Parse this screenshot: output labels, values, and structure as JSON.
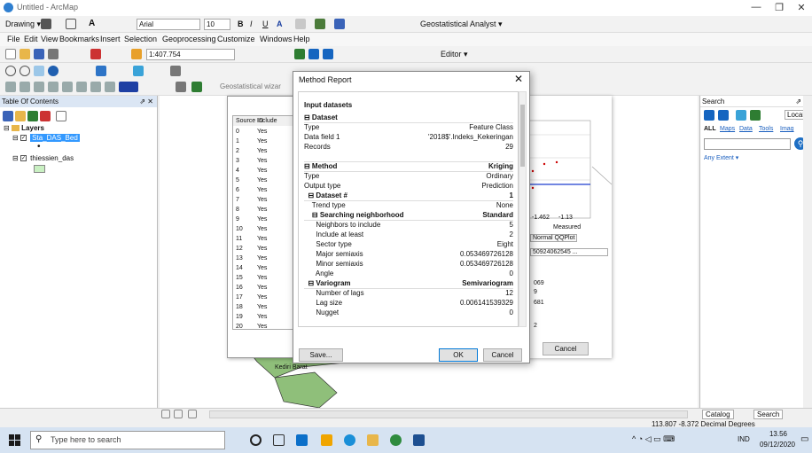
{
  "window": {
    "title": "Untitled - ArcMap",
    "minimize": "—",
    "maximize": "❐",
    "close": "✕"
  },
  "toolbar1": {
    "drawing": "Drawing ▾",
    "font": "Arial",
    "size": "10",
    "bold": "B",
    "italic": "I",
    "underline": "U",
    "font_color": "A",
    "geostat": "Geostatistical Analyst ▾"
  },
  "menu": [
    "File",
    "Edit",
    "View",
    "Bookmarks",
    "Insert",
    "Selection",
    "Geoprocessing",
    "Customize",
    "Windows",
    "Help"
  ],
  "toolbar2": {
    "scale": "1:407.754",
    "editor": "Editor ▾"
  },
  "geostat_wizard_label": "Geostatistical wizar",
  "toc": {
    "title": "Table Of Contents",
    "pin": "⇗ ✕",
    "layers_label": "Layers",
    "layer1": "Sta_DAS_Bed",
    "layer2": "thiessien_das"
  },
  "grid": {
    "headers": [
      "Source ID",
      "Include"
    ],
    "rows": [
      [
        "0",
        "Yes"
      ],
      [
        "1",
        "Yes"
      ],
      [
        "2",
        "Yes"
      ],
      [
        "3",
        "Yes"
      ],
      [
        "4",
        "Yes"
      ],
      [
        "5",
        "Yes"
      ],
      [
        "6",
        "Yes"
      ],
      [
        "7",
        "Yes"
      ],
      [
        "8",
        "Yes"
      ],
      [
        "9",
        "Yes"
      ],
      [
        "10",
        "Yes"
      ],
      [
        "11",
        "Yes"
      ],
      [
        "12",
        "Yes"
      ],
      [
        "13",
        "Yes"
      ],
      [
        "14",
        "Yes"
      ],
      [
        "15",
        "Yes"
      ],
      [
        "16",
        "Yes"
      ],
      [
        "17",
        "Yes"
      ],
      [
        "18",
        "Yes"
      ],
      [
        "19",
        "Yes"
      ],
      [
        "20",
        "Yes"
      ]
    ]
  },
  "method_report": {
    "title": "Method Report",
    "close": "✕",
    "heading": "Input datasets",
    "lines": [
      {
        "k": "⊟ Dataset",
        "v": "",
        "bold": true
      },
      {
        "k": "Type",
        "v": "Feature Class",
        "bold": false
      },
      {
        "k": "Data field 1",
        "v": "'2018$'.Indeks_Kekeringan",
        "bold": false
      },
      {
        "k": "Records",
        "v": "29",
        "bold": false
      },
      {
        "k": "",
        "v": "",
        "bold": false
      },
      {
        "k": "⊟ Method",
        "v": "Kriging",
        "bold": true
      },
      {
        "k": "Type",
        "v": "Ordinary",
        "bold": false
      },
      {
        "k": "Output type",
        "v": "Prediction",
        "bold": false
      },
      {
        "k": "  ⊟ Dataset #",
        "v": "1",
        "bold": true
      },
      {
        "k": "    Trend type",
        "v": "None",
        "bold": false
      },
      {
        "k": "    ⊟ Searching neighborhood",
        "v": "Standard",
        "bold": true
      },
      {
        "k": "      Neighbors to include",
        "v": "5",
        "bold": false
      },
      {
        "k": "      Include at least",
        "v": "2",
        "bold": false
      },
      {
        "k": "      Sector type",
        "v": "Eight",
        "bold": false
      },
      {
        "k": "      Major semiaxis",
        "v": "0.053469726128",
        "bold": false
      },
      {
        "k": "      Minor semiaxis",
        "v": "0.053469726128",
        "bold": false
      },
      {
        "k": "      Angle",
        "v": "0",
        "bold": false
      },
      {
        "k": "  ⊟ Variogram",
        "v": "Semivariogram",
        "bold": true
      },
      {
        "k": "      Number of lags",
        "v": "12",
        "bold": false
      },
      {
        "k": "      Lag size",
        "v": "0.006141539329",
        "bold": false
      },
      {
        "k": "      Nugget",
        "v": "0",
        "bold": false
      }
    ],
    "save": "Save...",
    "ok": "OK",
    "cancel": "Cancel"
  },
  "right_panel": {
    "ticks": [
      "-1.462",
      "-1.13"
    ],
    "measured": "Measured",
    "tab": "Normal QQPlot",
    "value": "50924062545 ...",
    "nums": [
      "069",
      "9",
      "681",
      "2"
    ],
    "cancel": "Cancel"
  },
  "map_label": "Kediri Barat",
  "search_pane": {
    "title": "Search",
    "pin": "⇗ ✕",
    "local": "Local",
    "links": [
      "ALL",
      "Maps",
      "Data",
      "Tools",
      "Imag"
    ],
    "extent": "Any Extent ▾",
    "catalog_tab": "Catalog",
    "search_tab": "Search"
  },
  "status": {
    "coords": "113.807  -8.372 Decimal Degrees"
  },
  "taskbar": {
    "search_placeholder": "Type here to search",
    "lang": "IND",
    "time": "13.56",
    "date": "09/12/2020"
  },
  "colors": {
    "accent": "#0078d7",
    "map_land": "#8fbf7a",
    "selection": "#3399ff"
  }
}
